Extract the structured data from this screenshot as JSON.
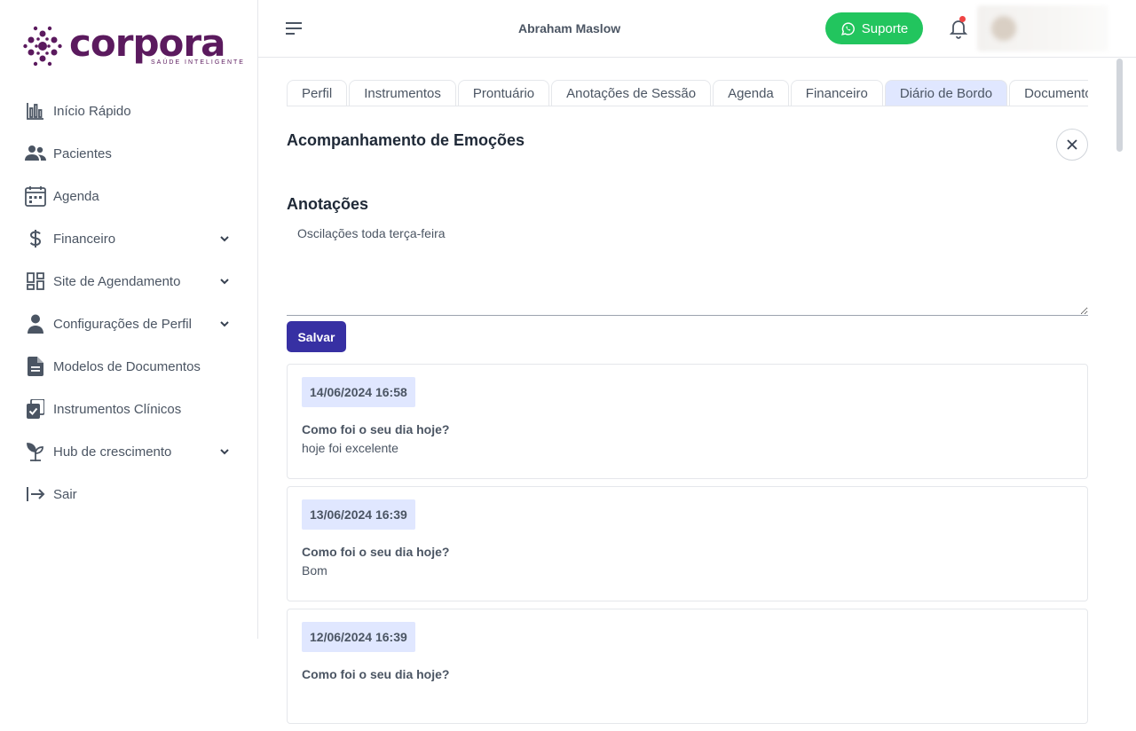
{
  "brand": {
    "name": "corpora",
    "tagline": "SAÚDE INTELIGENTE",
    "color": "#5b1a5e"
  },
  "sidebar": {
    "items": [
      {
        "label": "Início Rápido",
        "icon": "bar-chart-icon",
        "has_submenu": false
      },
      {
        "label": "Pacientes",
        "icon": "users-icon",
        "has_submenu": false
      },
      {
        "label": "Agenda",
        "icon": "calendar-icon",
        "has_submenu": false
      },
      {
        "label": "Financeiro",
        "icon": "dollar-icon",
        "has_submenu": true
      },
      {
        "label": "Site de Agendamento",
        "icon": "dashboard-icon",
        "has_submenu": true
      },
      {
        "label": "Configurações de Perfil",
        "icon": "user-icon",
        "has_submenu": true
      },
      {
        "label": "Modelos de Documentos",
        "icon": "document-icon",
        "has_submenu": false
      },
      {
        "label": "Instrumentos Clínicos",
        "icon": "clipboard-check-icon",
        "has_submenu": false
      },
      {
        "label": "Hub de crescimento",
        "icon": "sprout-icon",
        "has_submenu": true
      },
      {
        "label": "Sair",
        "icon": "logout-icon",
        "has_submenu": false
      }
    ]
  },
  "header": {
    "patient_name": "Abraham Maslow",
    "support_label": "Suporte",
    "support_color": "#22c55e",
    "notification_dot_color": "#ef4444"
  },
  "tabs": [
    {
      "label": "Perfil",
      "active": false
    },
    {
      "label": "Instrumentos",
      "active": false
    },
    {
      "label": "Prontuário",
      "active": false
    },
    {
      "label": "Anotações de Sessão",
      "active": false
    },
    {
      "label": "Agenda",
      "active": false
    },
    {
      "label": "Financeiro",
      "active": false
    },
    {
      "label": "Diário de Bordo",
      "active": true
    },
    {
      "label": "Documentos",
      "active": false
    }
  ],
  "main": {
    "section_title": "Acompanhamento de Emoções",
    "notes_label": "Anotações",
    "notes_value": "Oscilações toda terça-feira",
    "save_label": "Salvar",
    "accent_color": "#3730a3"
  },
  "entries": [
    {
      "date": "14/06/2024 16:58",
      "question": "Como foi o seu dia hoje?",
      "answer": "hoje foi excelente"
    },
    {
      "date": "13/06/2024 16:39",
      "question": "Como foi o seu dia hoje?",
      "answer": "Bom"
    },
    {
      "date": "12/06/2024 16:39",
      "question": "Como foi o seu dia hoje?",
      "answer": ""
    }
  ]
}
